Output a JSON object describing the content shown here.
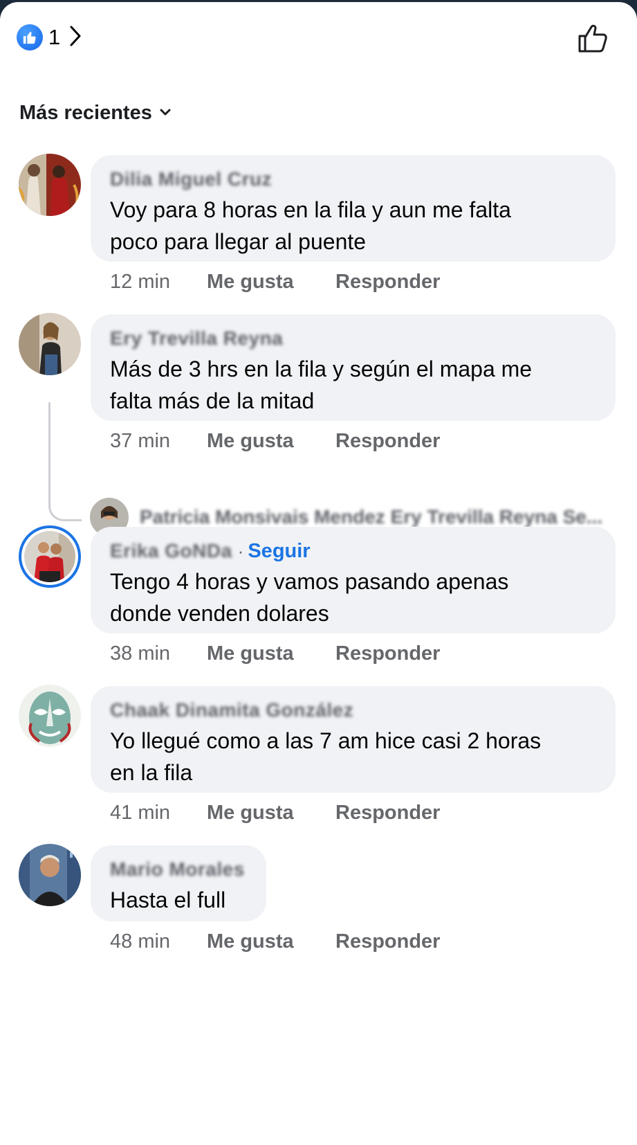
{
  "header": {
    "reaction_count": "1"
  },
  "sort": {
    "label": "Más recientes"
  },
  "comments": [
    {
      "author": "Dilia Miguel Cruz",
      "text_lines": [
        "Voy para 8 horas en la fila y aun me falta",
        "poco para llegar al puente"
      ],
      "time": "12 min",
      "like_label": "Me gusta",
      "reply_label": "Responder"
    },
    {
      "author": "Ery Trevilla Reyna",
      "text_lines": [
        "Más de 3 hrs en la fila y según el mapa me",
        "falta más de la mitad"
      ],
      "time": "37 min",
      "like_label": "Me gusta",
      "reply_label": "Responder"
    },
    {
      "author": "Erika GoNDa",
      "follow_label": "Seguir",
      "text_lines": [
        "Tengo 4 horas y vamos pasando apenas",
        "donde venden dolares"
      ],
      "time": "38 min",
      "like_label": "Me gusta",
      "reply_label": "Responder"
    },
    {
      "author": "Chaak Dinamita González",
      "text_lines": [
        "Yo llegué como a las 7 am hice casi 2 horas",
        "en la fila"
      ],
      "time": "41 min",
      "like_label": "Me gusta",
      "reply_label": "Responder"
    },
    {
      "author": "Mario Morales",
      "text_lines": [
        "Hasta el full"
      ],
      "time": "48 min",
      "like_label": "Me gusta",
      "reply_label": "Responder"
    }
  ],
  "reply_preview": {
    "text": "Patricia Monsivais Mendez Ery Trevilla Reyna Se..."
  },
  "icons": {
    "reaction": "like-badge-icon",
    "chevron": "chevron-right-icon",
    "like_outline": "thumbs-up-outline-icon",
    "sort": "chevron-down-icon"
  },
  "colors": {
    "accent": "#1b74e4",
    "bubble": "#f0f2f5",
    "muted": "#65676b"
  }
}
